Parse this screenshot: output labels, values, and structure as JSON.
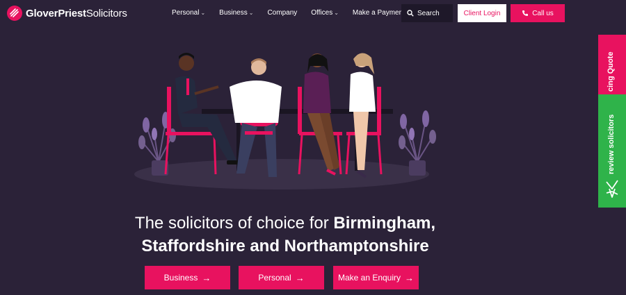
{
  "brand": {
    "name_bold": "GloverPriest",
    "name_regular": "Solicitors"
  },
  "nav": [
    {
      "label": "Personal",
      "dropdown": true
    },
    {
      "label": "Business",
      "dropdown": true
    },
    {
      "label": "Company",
      "dropdown": false
    },
    {
      "label": "Offices",
      "dropdown": true
    },
    {
      "label": "Make a Payment",
      "dropdown": false
    }
  ],
  "header": {
    "search_label": "Search",
    "client_login_label": "Client Login",
    "call_label": "Call us"
  },
  "side_tabs": {
    "quote_label": "cing Quote",
    "review_label": "review solicitors"
  },
  "hero": {
    "headline_regular": "The solicitors of choice for ",
    "headline_bold_1": "Birmingham,",
    "headline_bold_2": "Staffordshire and Northamptonshire"
  },
  "cta_buttons": [
    {
      "label": "Business",
      "arrow": "→"
    },
    {
      "label": "Personal",
      "arrow": "→"
    },
    {
      "label": "Make an Enquiry",
      "arrow": "→"
    }
  ],
  "colors": {
    "background": "#2b2238",
    "accent": "#e8125f",
    "review_green": "#2fb34a"
  },
  "icons": [
    "logo-mark-icon",
    "chevron-down-icon",
    "search-icon",
    "phone-icon",
    "review-solicitors-logo-icon",
    "arrow-right-icon"
  ]
}
